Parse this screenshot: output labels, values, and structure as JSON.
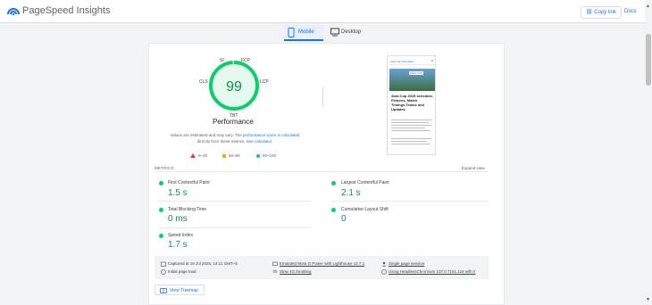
{
  "header": {
    "title": "PageSpeed Insights",
    "copy_link": "Copy link",
    "docs": "Docs",
    "link_icon": "link-icon"
  },
  "tabs": [
    {
      "label": "Mobile",
      "icon": "phone-icon"
    },
    {
      "label": "Desktop",
      "icon": "monitor-icon"
    }
  ],
  "performance": {
    "score": "99",
    "score_fraction": 0.99,
    "title": "Performance",
    "metric_labels": {
      "si": "SI",
      "fcp": "FCP",
      "cls": "CLS",
      "lcp": "LCP",
      "tbt": "TBT"
    },
    "note_prefix": "Values are estimated and may vary. The",
    "note_link1": "performance score is calculated",
    "note_mid": "directly from these metrics.",
    "note_link2": "See calculator.",
    "legend": [
      {
        "range": "0–49",
        "shape": "triangle",
        "color": "#e53935"
      },
      {
        "range": "50–89",
        "shape": "square",
        "color": "#ffa400"
      },
      {
        "range": "90–100",
        "shape": "circle",
        "color": "#0cce6b"
      }
    ],
    "gauge_color": "#0cce6b"
  },
  "screenshot": {
    "site_name": "Asia Cup Schedule",
    "close": "✕",
    "image_tag": "ASIA CUP",
    "headline": "Asia Cup 2025 schedule, Fixtures, Match Timings,Teams and Updates"
  },
  "metrics": {
    "header": "METRICS",
    "expand": "Expand view",
    "items": [
      {
        "name": "First Contentful Paint",
        "value": "1.5 s"
      },
      {
        "name": "Largest Contentful Paint",
        "value": "2.1 s"
      },
      {
        "name": "Total Blocking Time",
        "value": "0 ms"
      },
      {
        "name": "Cumulative Layout Shift",
        "value": "0"
      },
      {
        "name": "Speed Index",
        "value": "1.7 s"
      }
    ]
  },
  "run_info": {
    "captured": "Captured at 18 Jul 2025, 14:11 GMT+5",
    "initial_load": "Initial page load",
    "device": "Emulated Moto G Power with Lighthouse 12.7.1",
    "throttling": "Slow 4G throttling",
    "session": "Single page session",
    "browser": "Using HeadlessChromium 137.0.7151.119 with lr"
  },
  "treemap": {
    "label": "View Treemap",
    "icon": "treemap-icon"
  }
}
